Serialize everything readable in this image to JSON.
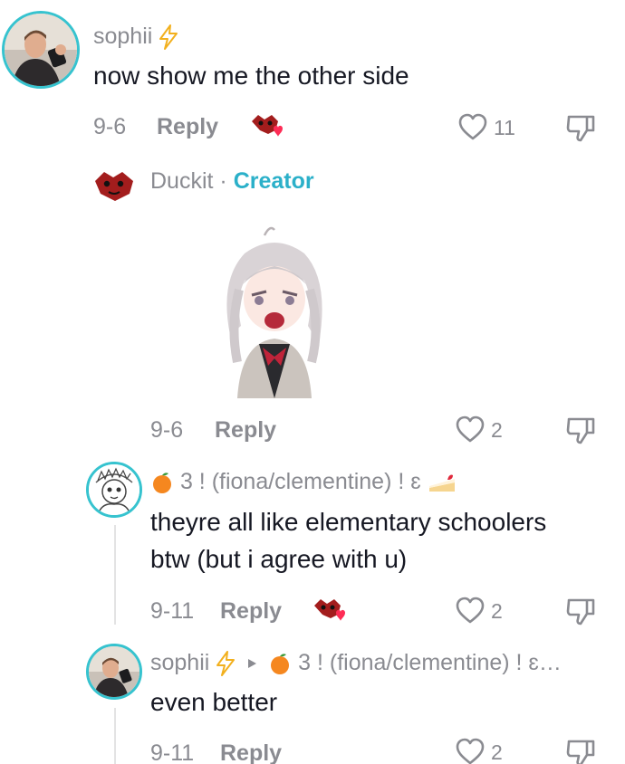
{
  "comments": [
    {
      "username": "sophii",
      "text": "now show me the other side",
      "date": "9-6",
      "reply_label": "Reply",
      "likes": "11"
    },
    {
      "username": "Duckit",
      "separator": "·",
      "creator_label": "Creator",
      "date": "9-6",
      "reply_label": "Reply",
      "likes": "2"
    },
    {
      "username": "3 ! (fiona/clementine) ! ɛ",
      "text_line1": "theyre all like elementary schoolers",
      "text_line2": "btw (but i agree with u)",
      "date": "9-11",
      "reply_label": "Reply",
      "likes": "2"
    },
    {
      "username": "sophii",
      "reply_to": "3 ! (fiona/clementine) ! ɛ…",
      "text": "even better",
      "date": "9-11",
      "reply_label": "Reply",
      "likes": "2"
    }
  ],
  "colors": {
    "creator": "#2bb0c9",
    "ring": "#36c3cf",
    "secondary_text": "#8a8b91",
    "liked_heart": "#fe2c55"
  },
  "icons": {
    "like": "heart-outline-icon",
    "dislike": "thumbs-down-icon",
    "creator_liked": "creator-heart-avatar-icon",
    "lightning": "lightning-icon",
    "orange": "orange-emoji",
    "cake": "cake-emoji",
    "reply_arrow": "triangle-right-icon"
  }
}
